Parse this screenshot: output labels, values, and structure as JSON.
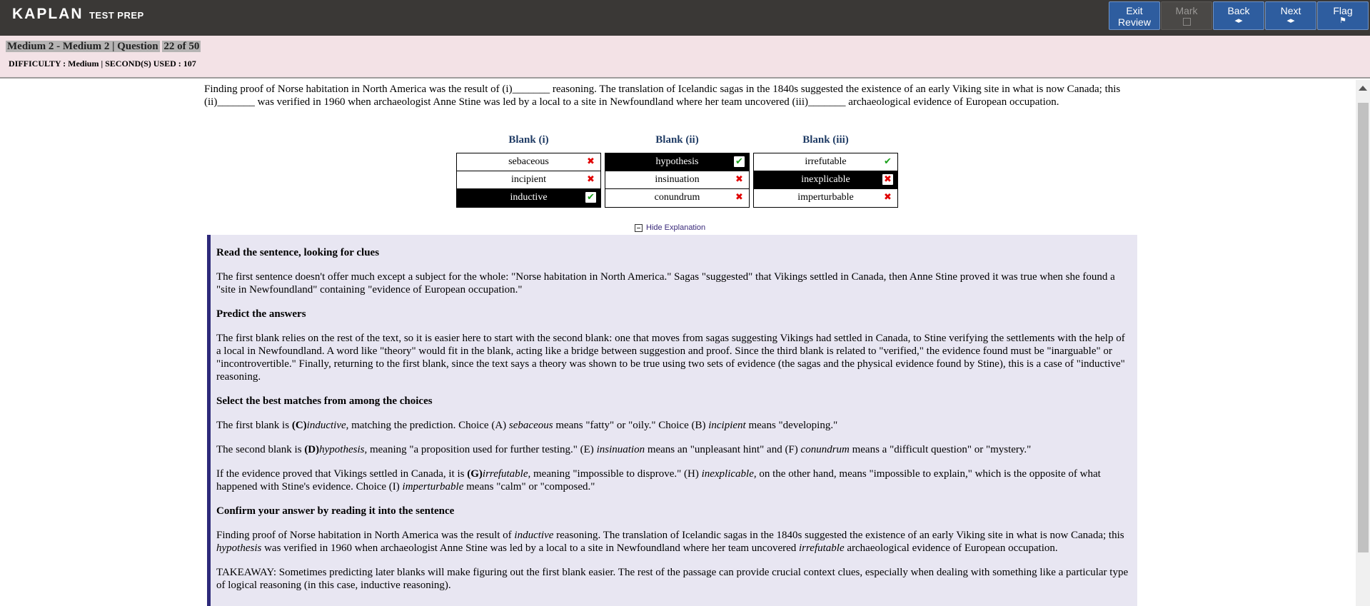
{
  "header": {
    "brand": "KAPLAN",
    "brand_sub": "TEST PREP",
    "buttons": {
      "exit_review_line1": "Exit",
      "exit_review_line2": "Review",
      "mark": "Mark",
      "back": "Back",
      "next": "Next",
      "flag": "Flag"
    }
  },
  "info": {
    "section": "Medium 2 - Medium 2 | Question",
    "position": "22 of 50",
    "meta": "DIFFICULTY : Medium | SECOND(S) USED : 107"
  },
  "question": {
    "stem": "Finding proof of Norse habitation in North America was the result of (i)_______ reasoning. The translation of Icelandic sagas in the 1840s suggested the existence of an early Viking site in what is now Canada; this (ii)_______ was verified in 1960 when archaeologist Anne Stine was led by a local to a site in Newfoundland where her team uncovered (iii)_______ archaeological evidence of European occupation.",
    "blanks": [
      {
        "header": "Blank (i)",
        "choices": [
          {
            "label": "sebaceous",
            "selected": false,
            "mark": "x"
          },
          {
            "label": "incipient",
            "selected": false,
            "mark": "x"
          },
          {
            "label": "inductive",
            "selected": true,
            "mark": "check"
          }
        ]
      },
      {
        "header": "Blank (ii)",
        "choices": [
          {
            "label": "hypothesis",
            "selected": true,
            "mark": "check"
          },
          {
            "label": "insinuation",
            "selected": false,
            "mark": "x"
          },
          {
            "label": "conundrum",
            "selected": false,
            "mark": "x"
          }
        ]
      },
      {
        "header": "Blank (iii)",
        "choices": [
          {
            "label": "irrefutable",
            "selected": false,
            "mark": "check"
          },
          {
            "label": "inexplicable",
            "selected": true,
            "mark": "x"
          },
          {
            "label": "imperturbable",
            "selected": false,
            "mark": "x"
          }
        ]
      }
    ]
  },
  "explanation": {
    "toggle_label": "Hide Explanation",
    "h1": "Read the sentence, looking for clues",
    "p1": "The first sentence doesn't offer much except a subject for the whole: \"Norse habitation in North America.\" Sagas \"suggested\" that Vikings settled in Canada, then Anne Stine proved it was true when she found a \"site in Newfoundland\" containing \"evidence of European occupation.\"",
    "h2": "Predict the answers",
    "p2": "The first blank relies on the rest of the text, so it is easier here to start with the second blank: one that moves from sagas suggesting Vikings had settled in Canada, to Stine verifying the settlements with the help of a local in Newfoundland. A word like \"theory\" would fit in the blank, acting like a bridge between suggestion and proof. Since the third blank is related to \"verified,\" the evidence found must be \"inarguable\" or \"incontrovertible.\"  Finally, returning to the first blank, since the text says a theory was shown to be true using two sets of evidence (the sagas and the physical evidence found by Stine), this is a case of \"inductive\" reasoning.",
    "h3": "Select the best matches from among the choices",
    "p3": {
      "a": "The first blank is ",
      "b": "(C)",
      "c": "inductive",
      "d": ", matching the prediction. Choice (A) ",
      "e": "sebaceous",
      "f": " means \"fatty\" or \"oily.\" Choice (B) ",
      "g": "incipient",
      "h": " means \"developing.\""
    },
    "p4": {
      "a": "The second blank is ",
      "b": "(D)",
      "c": "hypothesis",
      "d": ", meaning \"a proposition used for further testing.\" (E) ",
      "e": "insinuation",
      "f": " means an \"unpleasant hint\" and (F) ",
      "g": "conundrum",
      "h": " means a \"difficult question\" or \"mystery.\""
    },
    "p5": {
      "a": "If the evidence proved that Vikings settled in Canada, it is ",
      "b": "(G)",
      "c": "irrefutable",
      "d": ", meaning \"impossible to disprove.\" (H) ",
      "e": "inexplicable",
      "f": ", on the other hand, means \"impossible to explain,\" which is the opposite of what happened with Stine's evidence. Choice (I) ",
      "g": "imperturbable",
      "h": " means \"calm\" or \"composed.\""
    },
    "h4": "Confirm your answer by reading it into the sentence",
    "p6": {
      "a": "Finding proof of Norse habitation in North America was the result of ",
      "b": "inductive",
      "c": " reasoning. The translation of Icelandic sagas in the 1840s suggested the existence of an early Viking site in what is now Canada; this ",
      "d": "hypothesis",
      "e": " was verified in 1960 when archaeologist Anne Stine was led by a local to a site in Newfoundland where her team uncovered ",
      "f": "irrefutable",
      "g": " archaeological evidence of European occupation."
    },
    "p7": "TAKEAWAY: Sometimes predicting later blanks will make figuring out the first blank easier. The rest of the passage can provide crucial context clues, especially when dealing with something like a particular type of logical reasoning (in this case, inductive reasoning)."
  },
  "colors": {
    "topbar": "#3a3836",
    "nav_button": "#2e5d9f",
    "infobar": "#f3e2e6",
    "explanation_bg": "#e8e6f2",
    "explanation_border": "#2e2a7a",
    "blank_header": "#1f3b64",
    "incorrect_mark": "#e00000",
    "correct_mark": "#1aa01a"
  },
  "icons": {
    "correct": "check-icon",
    "incorrect": "x-icon",
    "back_arrow": "arrow-left-icon",
    "next_arrow": "arrow-right-icon",
    "flag": "flag-icon",
    "collapse": "minus-box-icon"
  }
}
